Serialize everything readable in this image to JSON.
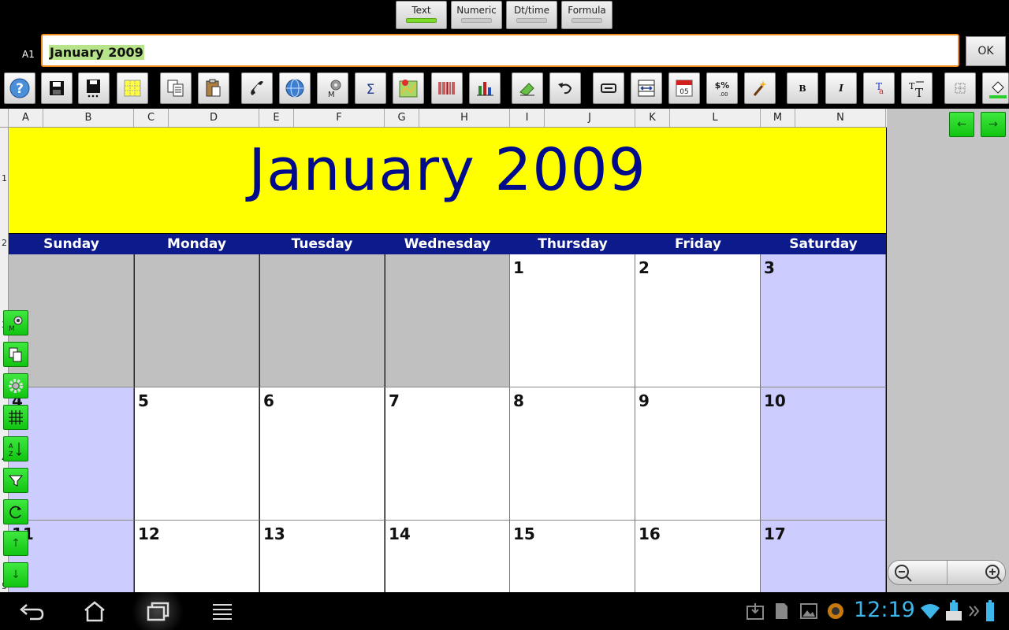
{
  "mode_tabs": [
    {
      "label": "Text",
      "active": true
    },
    {
      "label": "Numeric",
      "active": false
    },
    {
      "label": "Dt/time",
      "active": false
    },
    {
      "label": "Formula",
      "active": false
    }
  ],
  "formula_bar": {
    "cell_ref": "A1",
    "value": "January 2009",
    "ok_label": "OK"
  },
  "toolbar_icons": [
    "help-icon",
    "save-icon",
    "save-as-icon",
    "grid-select-icon",
    "copy-icon",
    "paste-icon",
    "phone-icon",
    "globe-icon",
    "macro-icon",
    "sum-icon",
    "map-icon",
    "barcode-icon",
    "chart-icon",
    "eraser-icon",
    "undo-icon",
    "wrap-icon",
    "fit-width-icon",
    "calendar-icon",
    "number-format-icon",
    "magic-wand-icon",
    "bold-icon",
    "italic-icon",
    "text-color-icon",
    "font-size-icon",
    "borders-icon",
    "fill-color-icon"
  ],
  "toolbar_text": {
    "calendar_day": "05",
    "number_format": "$%",
    "number_format_sub": ".00",
    "bold": "B",
    "italic": "I"
  },
  "columns": [
    "A",
    "B",
    "C",
    "D",
    "E",
    "F",
    "G",
    "H",
    "I",
    "J",
    "K",
    "L",
    "M",
    "N"
  ],
  "rows": [
    "1",
    "2",
    "3",
    "4",
    "5"
  ],
  "sheet": {
    "title": "January 2009",
    "weekdays": [
      "Sunday",
      "Monday",
      "Tuesday",
      "Wednesday",
      "Thursday",
      "Friday",
      "Saturday"
    ],
    "weeks": [
      [
        "",
        "",
        "",
        "",
        "1",
        "2",
        "3"
      ],
      [
        "4",
        "5",
        "6",
        "7",
        "8",
        "9",
        "10"
      ],
      [
        "11",
        "12",
        "13",
        "14",
        "15",
        "16",
        "17"
      ]
    ]
  },
  "colors": {
    "title_bg": "#ffff00",
    "title_text": "#000b8c",
    "weekday_bg": "#0d1a8c",
    "weekend_bg": "#ccccff",
    "empty_bg": "#c0c0c0",
    "accent_green": "#22d422",
    "focus_orange": "#f08b1d"
  },
  "nav_arrows": {
    "left": "←",
    "right": "→"
  },
  "side_buttons": [
    "macro-icon",
    "copy-icon",
    "gear-icon",
    "grid-icon",
    "sort-icon",
    "filter-icon",
    "refresh-icon",
    "up-arrow-icon",
    "down-arrow-icon"
  ],
  "side_arrows": {
    "up": "↑",
    "down": "↓"
  },
  "status_bar": {
    "time": "12:19"
  }
}
